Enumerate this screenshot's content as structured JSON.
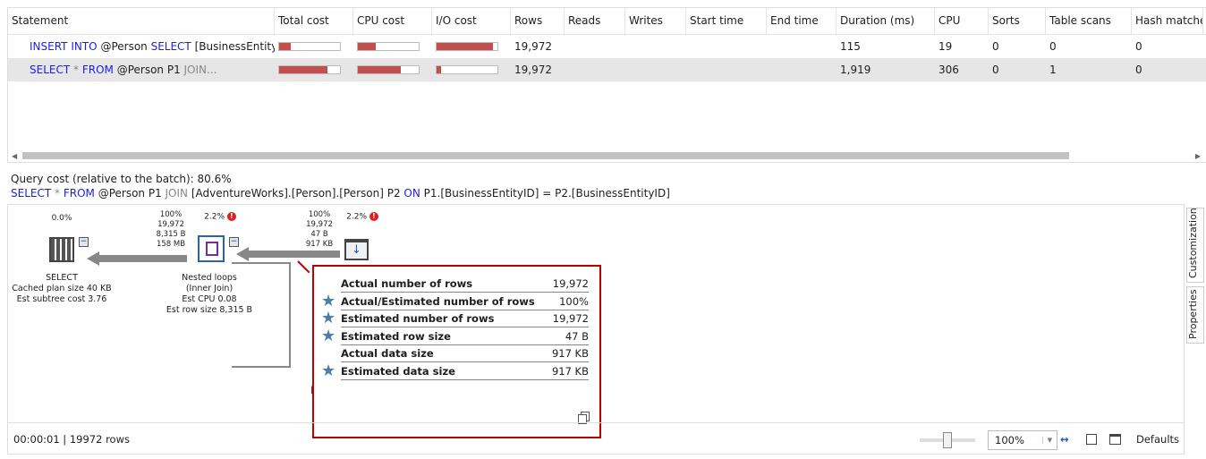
{
  "grid": {
    "columns": [
      "Statement",
      "Total cost",
      "CPU cost",
      "I/O cost",
      "Rows",
      "Reads",
      "Writes",
      "Start time",
      "End time",
      "Duration (ms)",
      "CPU",
      "Sorts",
      "Table scans",
      "Hash matches"
    ],
    "rows": [
      {
        "stmt": [
          {
            "t": "INSERT INTO",
            "c": "kw"
          },
          {
            "t": " @Person ",
            "c": ""
          },
          {
            "t": "SELECT",
            "c": "kw"
          },
          {
            "t": " [BusinessEntityID],...",
            "c": ""
          }
        ],
        "total": 0.19,
        "cpu": 0.3,
        "io": 0.93,
        "rows": "19,972",
        "reads": "",
        "writes": "",
        "start": "",
        "end": "",
        "duration": "115",
        "cpuv": "19",
        "sorts": "0",
        "scans": "0",
        "hash": "0"
      },
      {
        "stmt": [
          {
            "t": "SELECT",
            "c": "kw"
          },
          {
            "t": " * ",
            "c": "gr"
          },
          {
            "t": "FROM",
            "c": "kw"
          },
          {
            "t": " @Person P1 ",
            "c": ""
          },
          {
            "t": "JOIN...",
            "c": "gr"
          }
        ],
        "total": 0.8,
        "cpu": 0.7,
        "io": 0.07,
        "rows": "19,972",
        "reads": "",
        "writes": "",
        "start": "",
        "end": "",
        "duration": "1,919",
        "cpuv": "306",
        "sorts": "0",
        "scans": "1",
        "hash": "0"
      }
    ]
  },
  "query": {
    "cost_label": "Query cost (relative to the batch):  80.6%",
    "sql": [
      {
        "t": "SELECT",
        "c": "kw"
      },
      {
        "t": " * ",
        "c": "gr"
      },
      {
        "t": "FROM",
        "c": "kw"
      },
      {
        "t": " @Person P1 ",
        "c": ""
      },
      {
        "t": "JOIN",
        "c": "gr"
      },
      {
        "t": " [AdventureWorks].[Person].[Person] P2 ",
        "c": ""
      },
      {
        "t": "ON",
        "c": "kw"
      },
      {
        "t": " P1.[BusinessEntityID] = P2.[BusinessEntityID]",
        "c": ""
      }
    ]
  },
  "plan": {
    "select": {
      "pct": "0.0%",
      "name": "SELECT",
      "l2": "Cached plan size  40 KB",
      "l3": "Est subtree cost  3.76"
    },
    "edge1": [
      "100%",
      "19,972",
      "8,315 B",
      "158 MB"
    ],
    "nested": {
      "pct": "2.2%",
      "name": "Nested loops",
      "l2": "(Inner Join)",
      "l3": "Est CPU  0.08",
      "l4": "Est row size  8,315 B"
    },
    "edge2": [
      "100%",
      "19,972",
      "47 B",
      "917 KB"
    ],
    "scan": {
      "pct": "2.2%",
      "partial": "[P"
    }
  },
  "tooltip": {
    "rows": [
      {
        "label": "Actual number of rows",
        "value": "19,972",
        "star": false
      },
      {
        "label": "Actual/Estimated number of rows",
        "value": "100%",
        "star": true
      },
      {
        "label": "Estimated number of rows",
        "value": "19,972",
        "star": true
      },
      {
        "label": "Estimated row size",
        "value": "47 B",
        "star": true
      },
      {
        "label": "Actual data size",
        "value": "917 KB",
        "star": false
      },
      {
        "label": "Estimated data size",
        "value": "917 KB",
        "star": true
      }
    ]
  },
  "side": {
    "customization": "Customization",
    "properties": "Properties"
  },
  "status": {
    "text": "00:00:01 | 19972 rows",
    "zoom": "100%",
    "defaults": "Defaults",
    "zoom_level": 0.5
  }
}
